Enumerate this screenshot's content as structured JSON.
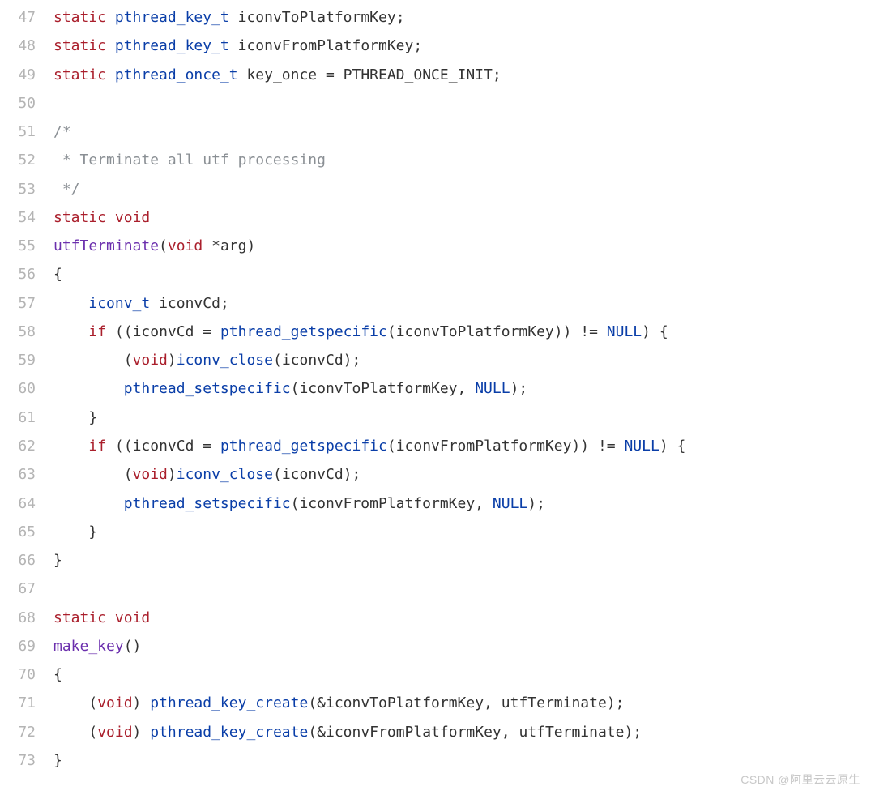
{
  "watermark": "CSDN @阿里云云原生",
  "lines": [
    {
      "n": "47",
      "tokens": [
        {
          "c": "kw",
          "t": "static"
        },
        {
          "c": "pun",
          "t": " "
        },
        {
          "c": "type",
          "t": "pthread_key_t"
        },
        {
          "c": "pun",
          "t": " "
        },
        {
          "c": "id",
          "t": "iconvToPlatformKey"
        },
        {
          "c": "pun",
          "t": ";"
        }
      ]
    },
    {
      "n": "48",
      "tokens": [
        {
          "c": "kw",
          "t": "static"
        },
        {
          "c": "pun",
          "t": " "
        },
        {
          "c": "type",
          "t": "pthread_key_t"
        },
        {
          "c": "pun",
          "t": " "
        },
        {
          "c": "id",
          "t": "iconvFromPlatformKey"
        },
        {
          "c": "pun",
          "t": ";"
        }
      ]
    },
    {
      "n": "49",
      "tokens": [
        {
          "c": "kw",
          "t": "static"
        },
        {
          "c": "pun",
          "t": " "
        },
        {
          "c": "type",
          "t": "pthread_once_t"
        },
        {
          "c": "pun",
          "t": " "
        },
        {
          "c": "id",
          "t": "key_once"
        },
        {
          "c": "pun",
          "t": " = "
        },
        {
          "c": "id",
          "t": "PTHREAD_ONCE_INIT"
        },
        {
          "c": "pun",
          "t": ";"
        }
      ]
    },
    {
      "n": "50",
      "tokens": []
    },
    {
      "n": "51",
      "tokens": [
        {
          "c": "cmt",
          "t": "/*"
        }
      ]
    },
    {
      "n": "52",
      "tokens": [
        {
          "c": "cmt",
          "t": " * Terminate all utf processing"
        }
      ]
    },
    {
      "n": "53",
      "tokens": [
        {
          "c": "cmt",
          "t": " */"
        }
      ]
    },
    {
      "n": "54",
      "tokens": [
        {
          "c": "kw",
          "t": "static"
        },
        {
          "c": "pun",
          "t": " "
        },
        {
          "c": "kw",
          "t": "void"
        }
      ]
    },
    {
      "n": "55",
      "tokens": [
        {
          "c": "func",
          "t": "utfTerminate"
        },
        {
          "c": "pun",
          "t": "("
        },
        {
          "c": "kw",
          "t": "void"
        },
        {
          "c": "pun",
          "t": " *"
        },
        {
          "c": "id",
          "t": "arg"
        },
        {
          "c": "pun",
          "t": ")"
        }
      ]
    },
    {
      "n": "56",
      "tokens": [
        {
          "c": "pun",
          "t": "{"
        }
      ]
    },
    {
      "n": "57",
      "tokens": [
        {
          "c": "pun",
          "t": "    "
        },
        {
          "c": "type",
          "t": "iconv_t"
        },
        {
          "c": "pun",
          "t": " "
        },
        {
          "c": "id",
          "t": "iconvCd"
        },
        {
          "c": "pun",
          "t": ";"
        }
      ]
    },
    {
      "n": "58",
      "tokens": [
        {
          "c": "pun",
          "t": "    "
        },
        {
          "c": "kw",
          "t": "if"
        },
        {
          "c": "pun",
          "t": " (("
        },
        {
          "c": "id",
          "t": "iconvCd"
        },
        {
          "c": "pun",
          "t": " = "
        },
        {
          "c": "call",
          "t": "pthread_getspecific"
        },
        {
          "c": "pun",
          "t": "("
        },
        {
          "c": "id",
          "t": "iconvToPlatformKey"
        },
        {
          "c": "pun",
          "t": ")) != "
        },
        {
          "c": "null",
          "t": "NULL"
        },
        {
          "c": "pun",
          "t": ") {"
        }
      ]
    },
    {
      "n": "59",
      "tokens": [
        {
          "c": "pun",
          "t": "        ("
        },
        {
          "c": "kw",
          "t": "void"
        },
        {
          "c": "pun",
          "t": ")"
        },
        {
          "c": "call",
          "t": "iconv_close"
        },
        {
          "c": "pun",
          "t": "("
        },
        {
          "c": "id",
          "t": "iconvCd"
        },
        {
          "c": "pun",
          "t": ");"
        }
      ]
    },
    {
      "n": "60",
      "tokens": [
        {
          "c": "pun",
          "t": "        "
        },
        {
          "c": "call",
          "t": "pthread_setspecific"
        },
        {
          "c": "pun",
          "t": "("
        },
        {
          "c": "id",
          "t": "iconvToPlatformKey"
        },
        {
          "c": "pun",
          "t": ", "
        },
        {
          "c": "null",
          "t": "NULL"
        },
        {
          "c": "pun",
          "t": ");"
        }
      ]
    },
    {
      "n": "61",
      "tokens": [
        {
          "c": "pun",
          "t": "    }"
        }
      ]
    },
    {
      "n": "62",
      "tokens": [
        {
          "c": "pun",
          "t": "    "
        },
        {
          "c": "kw",
          "t": "if"
        },
        {
          "c": "pun",
          "t": " (("
        },
        {
          "c": "id",
          "t": "iconvCd"
        },
        {
          "c": "pun",
          "t": " = "
        },
        {
          "c": "call",
          "t": "pthread_getspecific"
        },
        {
          "c": "pun",
          "t": "("
        },
        {
          "c": "id",
          "t": "iconvFromPlatformKey"
        },
        {
          "c": "pun",
          "t": ")) != "
        },
        {
          "c": "null",
          "t": "NULL"
        },
        {
          "c": "pun",
          "t": ") {"
        }
      ]
    },
    {
      "n": "63",
      "tokens": [
        {
          "c": "pun",
          "t": "        ("
        },
        {
          "c": "kw",
          "t": "void"
        },
        {
          "c": "pun",
          "t": ")"
        },
        {
          "c": "call",
          "t": "iconv_close"
        },
        {
          "c": "pun",
          "t": "("
        },
        {
          "c": "id",
          "t": "iconvCd"
        },
        {
          "c": "pun",
          "t": ");"
        }
      ]
    },
    {
      "n": "64",
      "tokens": [
        {
          "c": "pun",
          "t": "        "
        },
        {
          "c": "call",
          "t": "pthread_setspecific"
        },
        {
          "c": "pun",
          "t": "("
        },
        {
          "c": "id",
          "t": "iconvFromPlatformKey"
        },
        {
          "c": "pun",
          "t": ", "
        },
        {
          "c": "null",
          "t": "NULL"
        },
        {
          "c": "pun",
          "t": ");"
        }
      ]
    },
    {
      "n": "65",
      "tokens": [
        {
          "c": "pun",
          "t": "    }"
        }
      ]
    },
    {
      "n": "66",
      "tokens": [
        {
          "c": "pun",
          "t": "}"
        }
      ]
    },
    {
      "n": "67",
      "tokens": []
    },
    {
      "n": "68",
      "tokens": [
        {
          "c": "kw",
          "t": "static"
        },
        {
          "c": "pun",
          "t": " "
        },
        {
          "c": "kw",
          "t": "void"
        }
      ]
    },
    {
      "n": "69",
      "tokens": [
        {
          "c": "func",
          "t": "make_key"
        },
        {
          "c": "pun",
          "t": "()"
        }
      ]
    },
    {
      "n": "70",
      "tokens": [
        {
          "c": "pun",
          "t": "{"
        }
      ]
    },
    {
      "n": "71",
      "tokens": [
        {
          "c": "pun",
          "t": "    ("
        },
        {
          "c": "kw",
          "t": "void"
        },
        {
          "c": "pun",
          "t": ") "
        },
        {
          "c": "call",
          "t": "pthread_key_create"
        },
        {
          "c": "pun",
          "t": "(&"
        },
        {
          "c": "id",
          "t": "iconvToPlatformKey"
        },
        {
          "c": "pun",
          "t": ", "
        },
        {
          "c": "id",
          "t": "utfTerminate"
        },
        {
          "c": "pun",
          "t": ");"
        }
      ]
    },
    {
      "n": "72",
      "tokens": [
        {
          "c": "pun",
          "t": "    ("
        },
        {
          "c": "kw",
          "t": "void"
        },
        {
          "c": "pun",
          "t": ") "
        },
        {
          "c": "call",
          "t": "pthread_key_create"
        },
        {
          "c": "pun",
          "t": "(&"
        },
        {
          "c": "id",
          "t": "iconvFromPlatformKey"
        },
        {
          "c": "pun",
          "t": ", "
        },
        {
          "c": "id",
          "t": "utfTerminate"
        },
        {
          "c": "pun",
          "t": ");"
        }
      ]
    },
    {
      "n": "73",
      "tokens": [
        {
          "c": "pun",
          "t": "}"
        }
      ]
    }
  ]
}
